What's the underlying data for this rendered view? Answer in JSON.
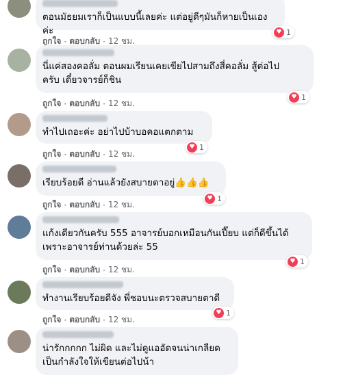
{
  "comments": [
    {
      "text": "ตอนมัธยมเราก็เป็นแบบนี้เลยค่ะ แต่อยู่ดีๆมันก็หายเป็นเองค่ะ",
      "reaction_count": "1",
      "like": "ถูกใจ",
      "reply": "ตอบกลับ",
      "time": "12 ชม."
    },
    {
      "text": "นี่แค่สองคอลั่ม ตอนผมเรียนเคยเขียไปสามถึงสี่คอลั่ม สู้ต่อไป\nครับ เดี๋ยวจารย์ก็ชิน",
      "reaction_count": "1",
      "like": "ถูกใจ",
      "reply": "ตอบกลับ",
      "time": "12 ชม."
    },
    {
      "text": "ทำไปเถอะค่ะ อย่าไปบ้าบอคอแตกตาม",
      "reaction_count": "1",
      "like": "ถูกใจ",
      "reply": "ตอบกลับ",
      "time": "12 ชม."
    },
    {
      "text": "เรียบร้อยดี อ่านแล้วยังสบายตาอยู่👍👍👍",
      "reaction_count": "1",
      "like": "ถูกใจ",
      "reply": "ตอบกลับ",
      "time": "12 ชม."
    },
    {
      "text": "แก้งเดียวกันครับ 555 อาจารย์บอกเหมือนกันเปี๊ยบ แต่ก็ดีขึ้นได้\nเพราะอาจารย์ท่านด้วยล่ะ 55",
      "reaction_count": "1",
      "like": "ถูกใจ",
      "reply": "ตอบกลับ",
      "time": "12 ชม."
    },
    {
      "text": "ทำงานเรียบร้อยดีจัง พี่ชอบนะตรวจสบายตาดี",
      "reaction_count": "1",
      "like": "ถูกใจ",
      "reply": "ตอบกลับ",
      "time": "12 ชม."
    },
    {
      "text": "น่ารักกกกก ไม่ผิด และไม่ดูแออัดจนน่าเกลียด\nเป็นกำลังใจให้เขียนต่อไปน้า"
    }
  ],
  "colors": {
    "bubble": "#f0f2f5",
    "heart": "#f33e58",
    "meta": "#65676b"
  },
  "icons": {
    "reaction": "heart-icon",
    "avatar": "user-avatar"
  }
}
